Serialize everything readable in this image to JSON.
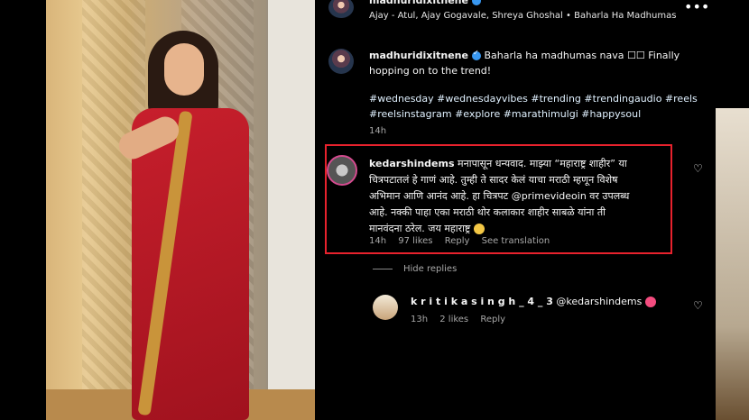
{
  "header": {
    "username": "madhuridixitnene",
    "audio": "Ajay - Atul, Ajay Gogavale, Shreya Ghoshal • Baharla Ha Madhumas",
    "close_icon": "close-icon"
  },
  "caption": {
    "username": "madhuridixitnene",
    "line1": "Baharla ha madhumas nava ☐☐ Finally",
    "line2": "hopping on to the trend!",
    "tags_line1": "#wednesday #wednesdayvibes #trending #trendingaudio #reels",
    "tags_line2": "#reelsinstagram #explore #marathimulgi #happysoul",
    "time": "14h"
  },
  "comment": {
    "username": "kedarshindems",
    "line1": "मनापासून धन्यवाद. माझ्या “महाराष्ट्र शाहीर” या",
    "line2": "चित्रपटातलं हे गाणं आहे. तुम्ही ते सादर केलं याचा मराठी म्हणून विशेष",
    "line3": "अभिमान आणि आनंद आहे. हा चित्रपट @primevideoin वर उपलब्ध",
    "line4": "आहे. नक्की पाहा एका मराठी थोर कलाकार शाहीर साबळे यांना ती",
    "line5": "मानवंदना ठरेल. जय महाराष्ट्र",
    "time": "14h",
    "likes": "97 likes",
    "reply": "Reply",
    "translate": "See translation"
  },
  "hide_replies": "Hide replies",
  "reply": {
    "username": "k r i t i k a s i n g h _ 4 _ 3",
    "text": "@kedarshindems",
    "time": "13h",
    "likes": "2 likes",
    "reply": "Reply"
  },
  "colors": {
    "highlight": "#e8222d",
    "verified": "#3897f0"
  }
}
